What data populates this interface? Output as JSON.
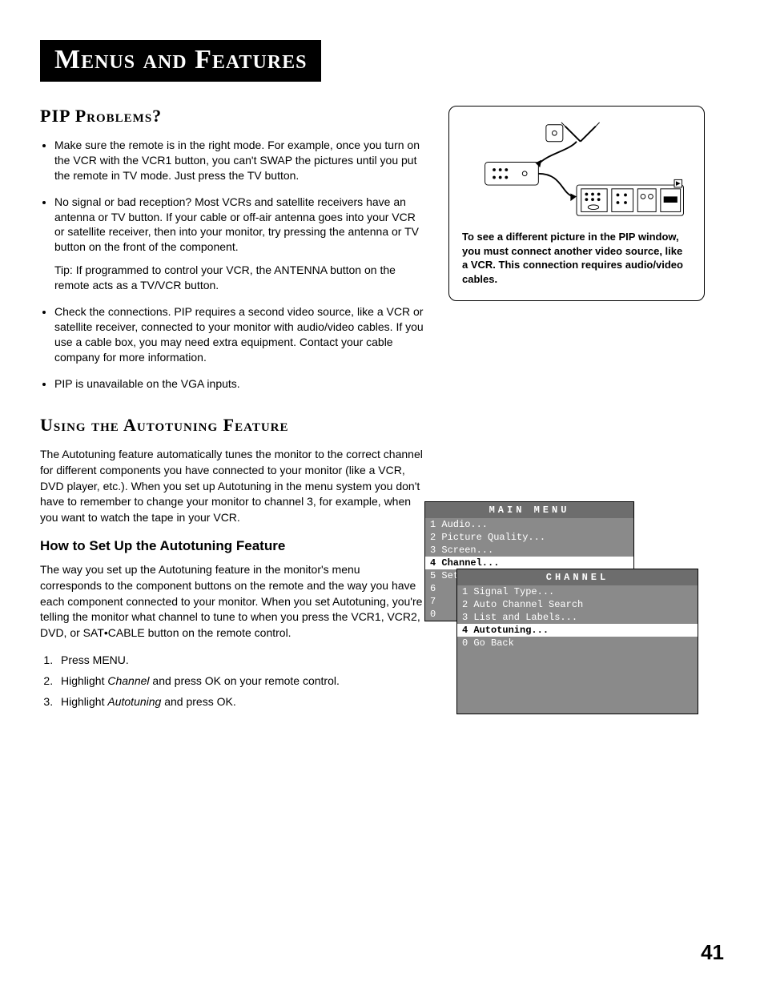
{
  "chapter_title": "Menus and Features",
  "section1": {
    "title": "PIP Problems?",
    "bullets": [
      "Make sure the remote is in the right mode.  For example, once you turn on the VCR with the VCR1 button, you can't SWAP the pictures until you put the remote in TV mode. Just press the TV button.",
      "No signal or bad reception? Most VCRs and satellite receivers have an antenna or TV button. If your cable or off-air antenna goes into your VCR or satellite receiver, then into your monitor, try pressing the antenna or TV button on the front of the component.",
      "Check the connections. PIP requires a second video source, like a VCR or satellite receiver, connected to your monitor with audio/video cables. If you use a cable box, you may need extra equipment. Contact your cable company for more information.",
      "PIP is unavailable on the VGA inputs."
    ],
    "tip": "Tip: If programmed to control your VCR, the ANTENNA button on the remote acts as a TV/VCR button."
  },
  "sidebox_text": "To see a different picture in the PIP window, you must connect another video source, like a VCR. This connection requires audio/video cables.",
  "section2": {
    "title": "Using the Autotuning Feature",
    "intro": "The Autotuning feature automatically tunes the monitor to the correct channel for different components you have connected to your monitor (like a VCR, DVD player, etc.). When you set up Autotuning in the menu system you don't have to remember to change your monitor to channel 3, for example, when you want to watch the tape in your VCR.",
    "sub_title": "How to Set Up the Autotuning Feature",
    "sub_para": "The way you set up the Autotuning feature in the monitor's menu corresponds to the component buttons on the remote and the way you have each component connected to your monitor. When you set Autotuning, you're telling the monitor what channel to tune to when you press the VCR1, VCR2, DVD, or SAT•CABLE button on the remote control.",
    "steps": {
      "s1": "Press MENU.",
      "s2_a": "Highlight ",
      "s2_i": "Channel",
      "s2_b": " and press OK on your remote control.",
      "s3_a": "Highlight ",
      "s3_i": "Autotuning",
      "s3_b": " and press OK."
    }
  },
  "main_menu": {
    "title": "MAIN MENU",
    "items": [
      {
        "n": "1",
        "label": "Audio..."
      },
      {
        "n": "2",
        "label": "Picture Quality..."
      },
      {
        "n": "3",
        "label": "Screen..."
      },
      {
        "n": "4",
        "label": "Channel...",
        "hl": true
      },
      {
        "n": "5",
        "label": "Set Time..."
      },
      {
        "n": "6",
        "label": ""
      },
      {
        "n": "7",
        "label": ""
      },
      {
        "n": "0",
        "label": ""
      }
    ]
  },
  "channel_menu": {
    "title": "CHANNEL",
    "items": [
      {
        "n": "1",
        "label": "Signal Type..."
      },
      {
        "n": "2",
        "label": "Auto Channel Search"
      },
      {
        "n": "3",
        "label": "List and Labels..."
      },
      {
        "n": "4",
        "label": "Autotuning...",
        "hl": true
      },
      {
        "n": "0",
        "label": "Go Back"
      }
    ]
  },
  "page_number": "41"
}
